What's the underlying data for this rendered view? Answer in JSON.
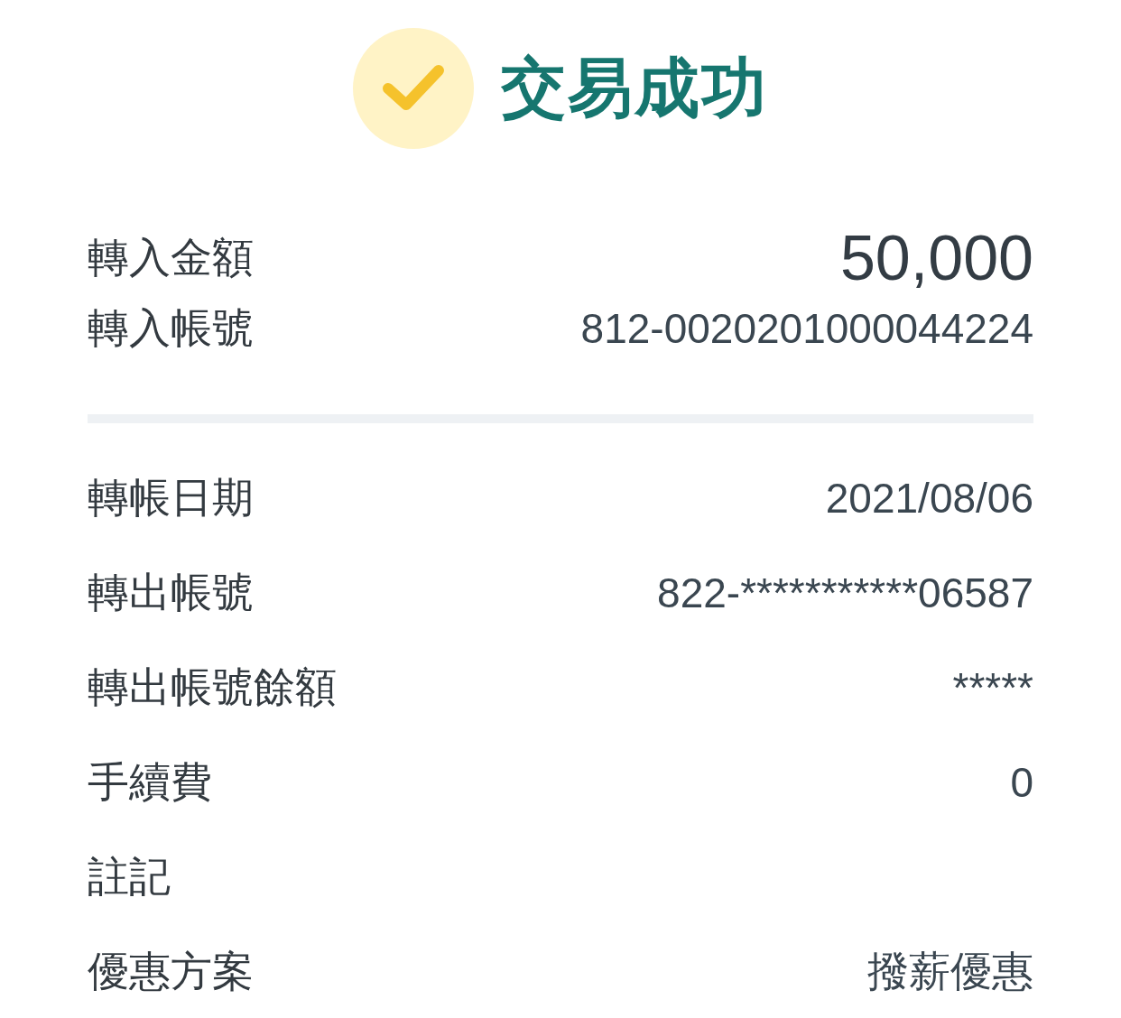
{
  "header": {
    "title": "交易成功",
    "success": true
  },
  "summary": [
    {
      "label": "轉入金額",
      "value": "50,000",
      "kind": "amount"
    },
    {
      "label": "轉入帳號",
      "value": "812-0020201000044224",
      "kind": "text"
    }
  ],
  "details": [
    {
      "label": "轉帳日期",
      "value": "2021/08/06"
    },
    {
      "label": "轉出帳號",
      "value": "822-***********06587"
    },
    {
      "label": "轉出帳號餘額",
      "value": "*****"
    },
    {
      "label": "手續費",
      "value": "0"
    },
    {
      "label": "註記"
    },
    {
      "label": "優惠方案",
      "value": "撥薪優惠"
    }
  ]
}
